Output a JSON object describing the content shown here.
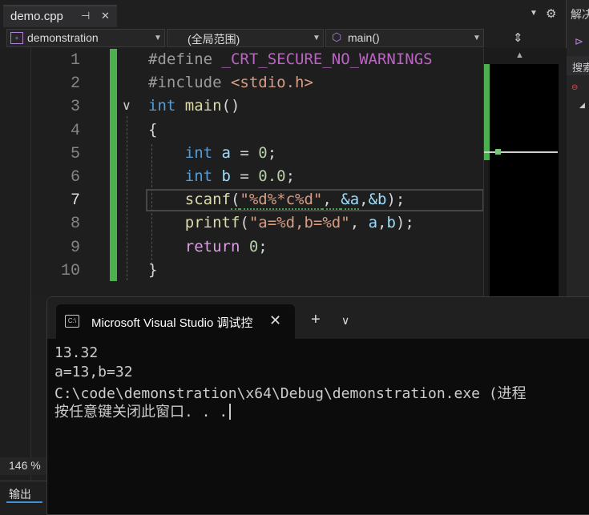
{
  "tab": {
    "title": "demo.cpp",
    "pin_icon": "pin-icon",
    "close_icon": "close-icon"
  },
  "top_right": {
    "dropdown_icon": "chevron-down-icon",
    "gear_icon": "gear-icon"
  },
  "right_panel": {
    "title": "解决",
    "search": "搜索"
  },
  "navbar": {
    "project": "demonstration",
    "scope": "(全局范围)",
    "function": "main()"
  },
  "editor": {
    "line_numbers": [
      "1",
      "2",
      "3",
      "4",
      "5",
      "6",
      "7",
      "8",
      "9",
      "10"
    ],
    "active_line": "7",
    "lines": [
      [
        {
          "t": "#define ",
          "c": "pp"
        },
        {
          "t": "_CRT_SECURE_NO_WARNINGS",
          "c": "mac"
        }
      ],
      [
        {
          "t": "#include ",
          "c": "pp"
        },
        {
          "t": "<stdio.h>",
          "c": "str"
        }
      ],
      [
        {
          "t": "int ",
          "c": "kw"
        },
        {
          "t": "main",
          "c": "fn"
        },
        {
          "t": "()",
          "c": "plain"
        }
      ],
      [
        {
          "t": "{",
          "c": "plain"
        }
      ],
      [
        {
          "t": "    int ",
          "c": "kw"
        },
        {
          "t": "a",
          "c": "var"
        },
        {
          "t": " = ",
          "c": "plain"
        },
        {
          "t": "0",
          "c": "num"
        },
        {
          "t": ";",
          "c": "plain"
        }
      ],
      [
        {
          "t": "    int ",
          "c": "kw"
        },
        {
          "t": "b",
          "c": "var"
        },
        {
          "t": " = ",
          "c": "plain"
        },
        {
          "t": "0.0",
          "c": "num"
        },
        {
          "t": ";",
          "c": "plain"
        }
      ],
      [
        {
          "t": "    scanf",
          "c": "fn"
        },
        {
          "t": "(",
          "c": "plain"
        },
        {
          "t": "\"%d%*c%d\"",
          "c": "str"
        },
        {
          "t": ", ",
          "c": "plain"
        },
        {
          "t": "&a",
          "c": "var"
        },
        {
          "t": ",",
          "c": "plain"
        },
        {
          "t": "&b",
          "c": "var"
        },
        {
          "t": ");",
          "c": "plain"
        }
      ],
      [
        {
          "t": "    printf",
          "c": "fn"
        },
        {
          "t": "(",
          "c": "plain"
        },
        {
          "t": "\"a=%d,b=%d\"",
          "c": "str"
        },
        {
          "t": ", ",
          "c": "plain"
        },
        {
          "t": "a",
          "c": "var"
        },
        {
          "t": ",",
          "c": "plain"
        },
        {
          "t": "b",
          "c": "var"
        },
        {
          "t": ");",
          "c": "plain"
        }
      ],
      [
        {
          "t": "    return ",
          "c": "ctl"
        },
        {
          "t": "0",
          "c": "num"
        },
        {
          "t": ";",
          "c": "plain"
        }
      ],
      [
        {
          "t": "}",
          "c": "plain"
        }
      ]
    ]
  },
  "console": {
    "tab_title": "Microsoft Visual Studio 调试控",
    "output": [
      "13.32",
      "a=13,b=32",
      "C:\\code\\demonstration\\x64\\Debug\\demonstration.exe (进程",
      "按任意键关闭此窗口. . ."
    ]
  },
  "status": {
    "zoom": "146 %"
  },
  "output_panel": {
    "label": "输出"
  }
}
